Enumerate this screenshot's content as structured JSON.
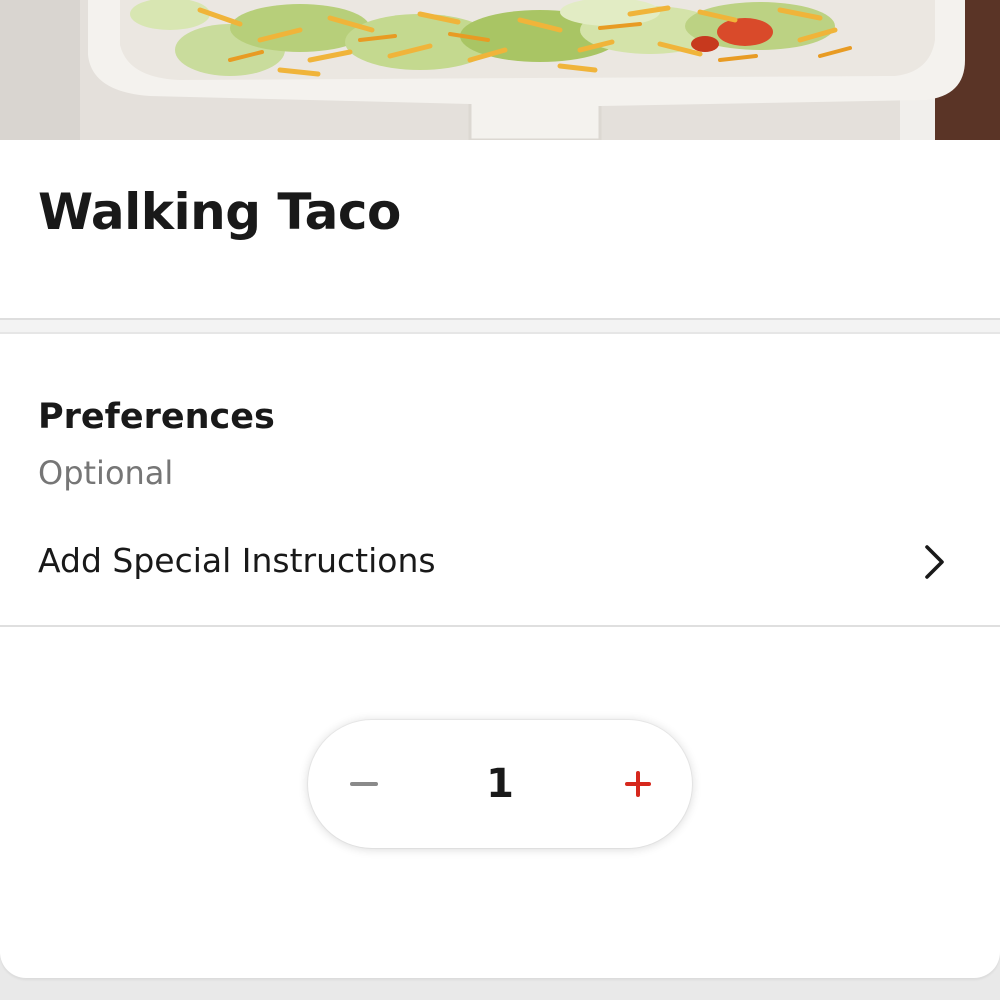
{
  "item": {
    "title": "Walking Taco",
    "image_icon": "food-photo"
  },
  "preferences": {
    "title": "Preferences",
    "subtitle": "Optional",
    "instructions_label": "Add Special Instructions",
    "instructions_icon": "chevron-right-icon"
  },
  "quantity": {
    "value": "1",
    "minus_icon": "minus-icon",
    "plus_icon": "plus-icon"
  },
  "colors": {
    "accent": "#d6281d",
    "text_primary": "#191919",
    "text_secondary": "#767676",
    "minus_disabled": "#8a8a8a"
  }
}
